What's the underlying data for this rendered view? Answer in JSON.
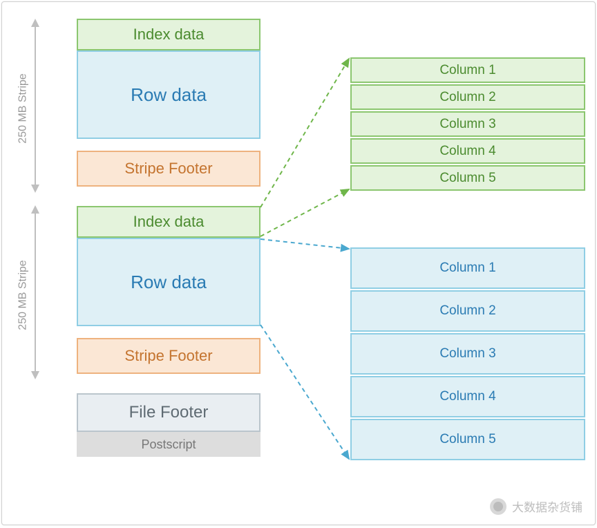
{
  "stripe_label": "250 MB Stripe",
  "stripe1": {
    "index": "Index data",
    "row": "Row data",
    "footer": "Stripe Footer"
  },
  "stripe2": {
    "index": "Index data",
    "row": "Row data",
    "footer": "Stripe Footer"
  },
  "file_footer": "File Footer",
  "postscript": "Postscript",
  "index_columns": [
    "Column 1",
    "Column 2",
    "Column 3",
    "Column 4",
    "Column 5"
  ],
  "row_columns": [
    "Column 1",
    "Column 2",
    "Column 3",
    "Column 4",
    "Column 5"
  ],
  "watermark": "大数据杂货铺",
  "colors": {
    "green_border": "#8bc66f",
    "blue_border": "#8fcee4"
  }
}
